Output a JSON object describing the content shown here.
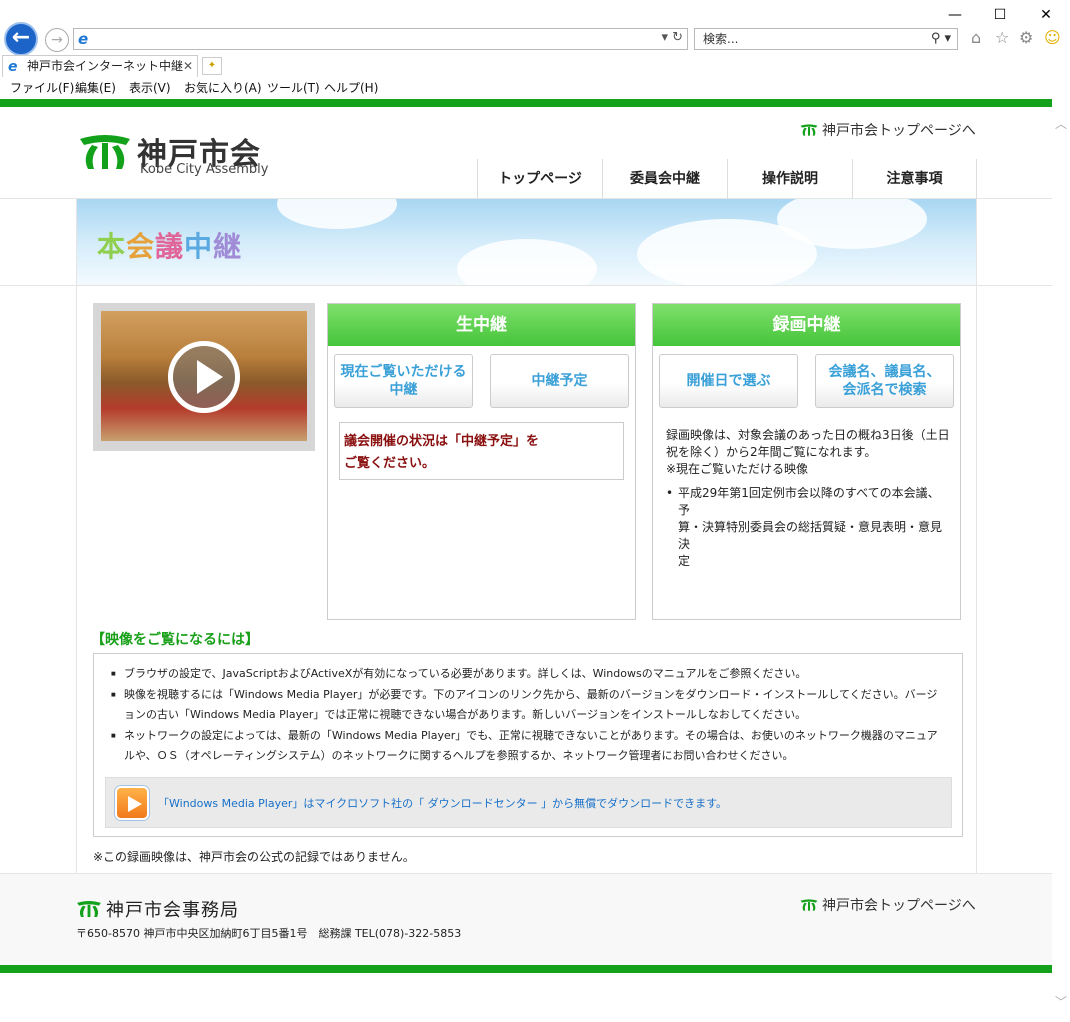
{
  "browser": {
    "window_controls": [
      "—",
      "☐",
      "✕"
    ],
    "address_value": "",
    "search_placeholder": "検索...",
    "tab_title": "神戸市会インターネット中継",
    "menu": [
      "ファイル(F)",
      "編集(E)",
      "表示(V)",
      "お気に入り(A)",
      "ツール(T)",
      "ヘルプ(H)"
    ]
  },
  "header": {
    "logo_jp": "神戸市会",
    "logo_en": "Kobe City Assembly",
    "top_link": "神戸市会トップページへ",
    "nav": [
      "トップページ",
      "委員会中継",
      "操作説明",
      "注意事項"
    ]
  },
  "banner": {
    "title_chars": [
      "本",
      "会",
      "議",
      "中",
      "継"
    ]
  },
  "live": {
    "header": "生中継",
    "btn_current": [
      "現在ご覧いただける",
      "中継"
    ],
    "btn_schedule": "中継予定",
    "notice_lines": [
      "議会開催の状況は「中継予定」を",
      "ご覧ください。"
    ]
  },
  "recorded": {
    "header": "録画中継",
    "btn_by_date": "開催日で選ぶ",
    "btn_search": [
      "会議名、議員名、",
      "会派名で検索"
    ],
    "text_lines": [
      "録画映像は、対象会議のあった日の概ね3日後（土日",
      "祝を除く）から2年間ご覧になれます。",
      "※現在ご覧いただける映像"
    ],
    "list": [
      "平成29年第1回定例市会以降のすべての本会議、予",
      "算・決算特別委員会の総括質疑・意見表明・意見決",
      "定"
    ]
  },
  "howto": {
    "title": "【映像をご覧になるには】",
    "items": [
      "ブラウザの設定で、JavaScriptおよびActiveXが有効になっている必要があります。詳しくは、Windowsのマニュアルをご参照ください。",
      "映像を視聴するには「Windows Media Player」が必要です。下のアイコンのリンク先から、最新のバージョンをダウンロード・インストールしてください。バージョンの古い「Windows Media Player」では正常に視聴できない場合があります。新しいバージョンをインストールしなおしてください。",
      "ネットワークの設定によっては、最新の「Windows Media Player」でも、正常に視聴できないことがあります。その場合は、お使いのネットワーク機器のマニュアルや、ＯＳ（オペレーティングシステム）のネットワークに関するヘルプを参照するか、ネットワーク管理者にお問い合わせください。"
    ],
    "wmp_text": "「Windows Media Player」はマイクロソフト社の「 ダウンロードセンター 」から無償でダウンロードできます。"
  },
  "disclaimer": "※この録画映像は、神戸市会の公式の記録ではありません。",
  "footer": {
    "org": "神戸市会事務局",
    "address": "〒650-8570 神戸市中央区加納町6丁目5番1号　総務課 TEL(078)-322-5853",
    "top_link": "神戸市会トップページへ"
  },
  "colors": {
    "brand_green": "#13a01a",
    "panel_green": "#45c43a",
    "button_text_blue": "#3aa0d8",
    "notice_red": "#8a1010"
  }
}
